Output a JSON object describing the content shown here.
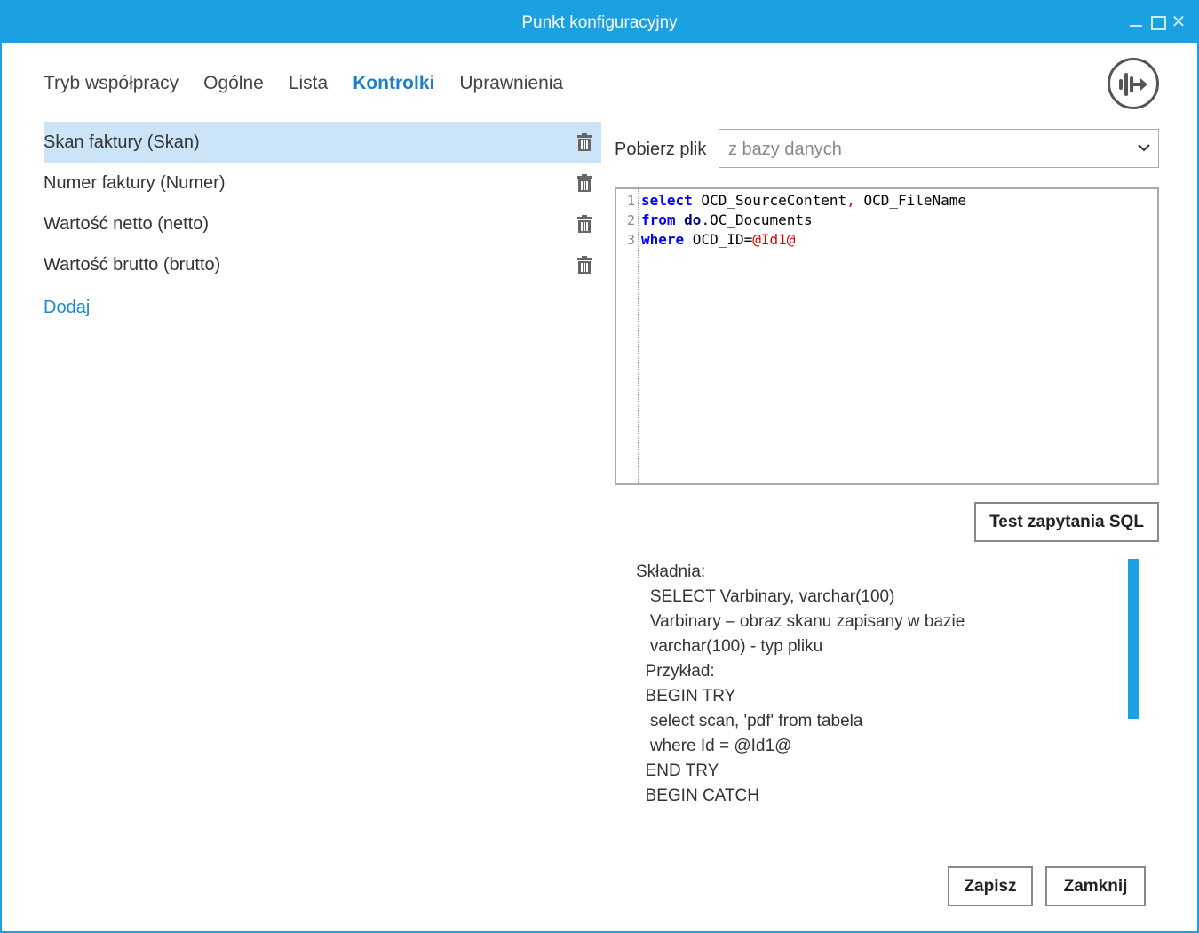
{
  "window": {
    "title": "Punkt konfiguracyjny"
  },
  "tabs": [
    {
      "label": "Tryb współpracy",
      "active": false
    },
    {
      "label": "Ogólne",
      "active": false
    },
    {
      "label": "Lista",
      "active": false
    },
    {
      "label": "Kontrolki",
      "active": true
    },
    {
      "label": "Uprawnienia",
      "active": false
    }
  ],
  "controls": {
    "items": [
      {
        "label": "Skan faktury (Skan)",
        "selected": true
      },
      {
        "label": "Numer faktury (Numer)",
        "selected": false
      },
      {
        "label": "Wartość netto (netto)",
        "selected": false
      },
      {
        "label": "Wartość brutto (brutto)",
        "selected": false
      }
    ],
    "add_label": "Dodaj"
  },
  "fetch": {
    "label": "Pobierz plik",
    "value": "z bazy danych"
  },
  "editor": {
    "line_numbers": [
      "1",
      "2",
      "3"
    ],
    "line1": {
      "kw": "select",
      "rest": " OCD_SourceContent",
      "comma": ",",
      "rest2": " OCD_FileName"
    },
    "line2": {
      "kw": "from",
      "kw2": " do",
      "rest": ".OC_Documents"
    },
    "line3": {
      "kw": "where",
      "rest": " OCD_ID=",
      "var": "@Id1@"
    }
  },
  "test_button": "Test zapytania SQL",
  "syntax_help": [
    "Składnia:",
    "   SELECT Varbinary, varchar(100)",
    "   Varbinary – obraz skanu zapisany w bazie",
    "   varchar(100) - typ pliku",
    "  Przykład:",
    "  BEGIN TRY",
    "   select scan, 'pdf' from tabela",
    "   where Id = @Id1@",
    "  END TRY",
    "  BEGIN CATCH"
  ],
  "footer": {
    "save": "Zapisz",
    "close": "Zamknij"
  },
  "colors": {
    "accent": "#1ba1e2",
    "active_tab": "#1a7fc8",
    "selected_row": "#cce4f7",
    "sql_keyword": "#0000ff",
    "sql_variable": "#e00000"
  }
}
